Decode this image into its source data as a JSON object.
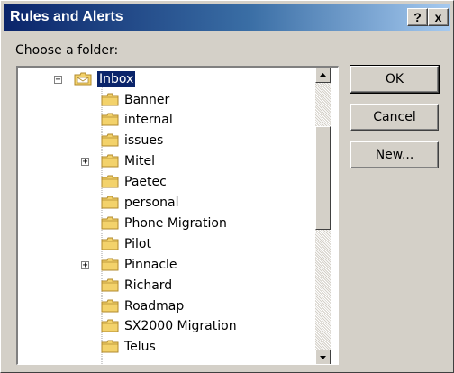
{
  "window": {
    "title": "Rules and Alerts",
    "help_glyph": "?",
    "close_glyph": "x"
  },
  "dialog": {
    "prompt": "Choose a folder:"
  },
  "tree": {
    "root": {
      "label": "Inbox",
      "expander": "−",
      "selected": true,
      "icon": "inbox-folder-icon"
    },
    "children": [
      {
        "label": "Banner",
        "expander": null,
        "icon": "folder-icon"
      },
      {
        "label": "internal",
        "expander": null,
        "icon": "folder-icon"
      },
      {
        "label": "issues",
        "expander": null,
        "icon": "folder-icon"
      },
      {
        "label": "Mitel",
        "expander": "+",
        "icon": "folder-icon"
      },
      {
        "label": "Paetec",
        "expander": null,
        "icon": "folder-icon"
      },
      {
        "label": "personal",
        "expander": null,
        "icon": "folder-icon"
      },
      {
        "label": "Phone Migration",
        "expander": null,
        "icon": "folder-icon"
      },
      {
        "label": "Pilot",
        "expander": null,
        "icon": "folder-icon"
      },
      {
        "label": "Pinnacle",
        "expander": "+",
        "icon": "folder-icon"
      },
      {
        "label": "Richard",
        "expander": null,
        "icon": "folder-icon"
      },
      {
        "label": "Roadmap",
        "expander": null,
        "icon": "folder-icon"
      },
      {
        "label": "SX2000 Migration",
        "expander": null,
        "icon": "folder-icon"
      },
      {
        "label": "Telus",
        "expander": null,
        "icon": "folder-icon"
      }
    ]
  },
  "buttons": {
    "ok": "OK",
    "cancel": "Cancel",
    "new": "New..."
  },
  "colors": {
    "titlebar_start": "#0a246a",
    "titlebar_end": "#a6caf0",
    "dialog_face": "#d4d0c8",
    "selection": "#0a246a",
    "folder_yellow": "#f3d26b"
  }
}
